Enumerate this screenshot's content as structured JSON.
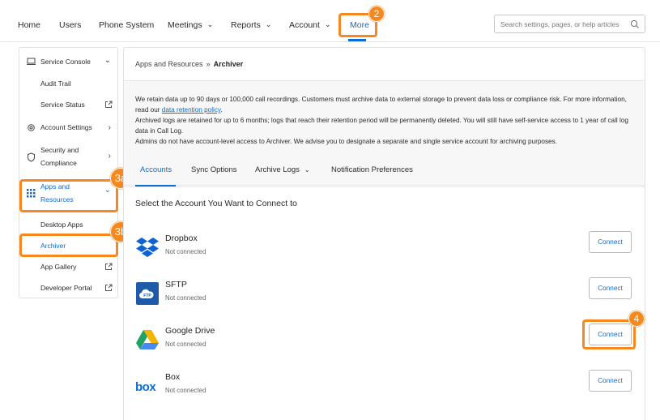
{
  "nav": {
    "home": "Home",
    "users": "Users",
    "phone_system": "Phone System",
    "meetings": "Meetings",
    "reports": "Reports",
    "account": "Account",
    "more": "More",
    "search_placeholder": "Search settings, pages, or help articles"
  },
  "callouts": {
    "c2": "2",
    "c3a": "3a",
    "c3b": "3b",
    "c4": "4",
    "color": "#f5891f"
  },
  "sidebar": {
    "items": [
      {
        "label": "Service Console",
        "icon": "monitor-icon"
      },
      {
        "label": "Audit Trail"
      },
      {
        "label": "Service Status",
        "icon": "external-link-icon"
      },
      {
        "label": "Account Settings",
        "icon": "gear-icon"
      },
      {
        "label": "Security and",
        "label2": "Compliance",
        "icon": "shield-icon"
      },
      {
        "label": "Apps and",
        "label2": "Resources",
        "icon": "grid-icon"
      },
      {
        "label": "Desktop Apps"
      },
      {
        "label": "Archiver"
      },
      {
        "label": "App Gallery",
        "icon": "external-link-icon"
      },
      {
        "label": "Developer Portal",
        "icon": "external-link-icon"
      }
    ]
  },
  "main": {
    "breadcrumb_parent": "Apps and Resources",
    "breadcrumb_sep": "»",
    "breadcrumb_current": "Archiver",
    "info": {
      "line1a": "We retain data up to 90 days or 100,000 call recordings. Customers must archive data to external storage to prevent data loss or compliance risk. For more information, read our ",
      "link": "data retention policy",
      "line1b": ".",
      "line2": "Archived logs are retained for up to 6 months; logs that reach their retention period will be permanently deleted. You will still have self-service access to 1 year of call log data in Call Log.",
      "line3": "Admins do not have account-level access to Archiver. We advise you to designate a separate and single service account for archiving purposes."
    },
    "tabs": [
      "Accounts",
      "Sync Options",
      "Archive Logs",
      "Notification Preferences"
    ],
    "section_title": "Select the Account You Want to Connect to",
    "accounts": [
      {
        "name": "Dropbox",
        "status": "Not connected",
        "button": "Connect"
      },
      {
        "name": "SFTP",
        "status": "Not connected",
        "button": "Connect"
      },
      {
        "name": "Google Drive",
        "status": "Not connected",
        "button": "Connect"
      },
      {
        "name": "Box",
        "status": "Not connected",
        "button": "Connect"
      }
    ],
    "accent": "#0b6cd6"
  }
}
